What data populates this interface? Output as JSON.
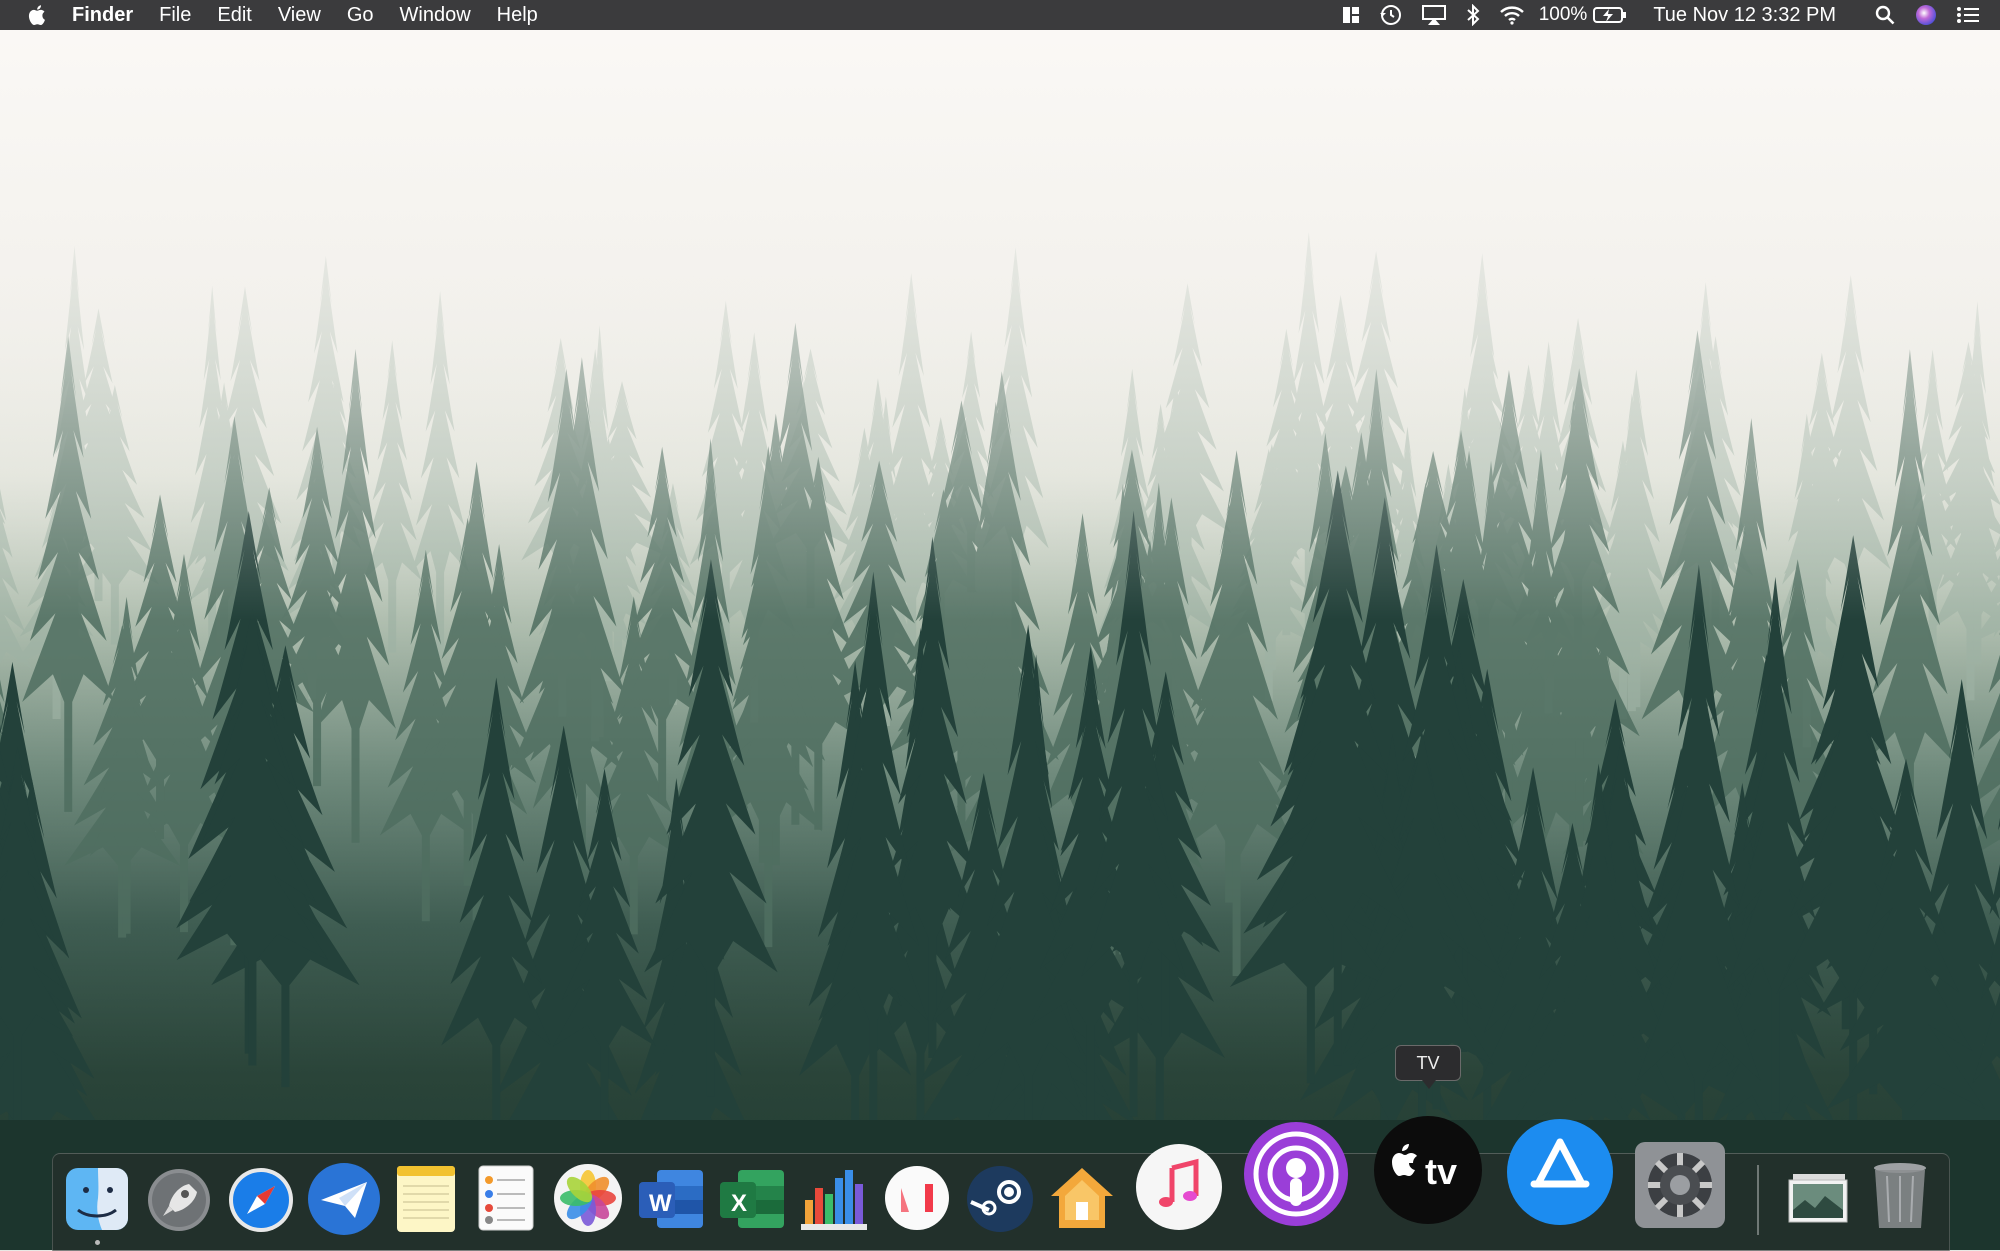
{
  "menubar": {
    "apple_icon": "apple-logo-icon",
    "app_name": "Finder",
    "menus": [
      "File",
      "Edit",
      "View",
      "Go",
      "Window",
      "Help"
    ],
    "battery_percent": "100%",
    "clock": "Tue Nov 12  3:32 PM",
    "status_icons": [
      "mission-control-icon",
      "time-machine-icon",
      "airplay-icon",
      "bluetooth-icon",
      "wifi-icon",
      "battery-charging-icon",
      "spotlight-search-icon",
      "siri-icon",
      "notification-center-icon"
    ]
  },
  "dock": {
    "tooltip": "TV",
    "apps": [
      "Finder",
      "Launchpad",
      "Safari",
      "Airmail",
      "Notes",
      "Reminders",
      "Photos",
      "Word",
      "Excel",
      "Numbers",
      "News",
      "Steam",
      "Home",
      "Music",
      "Podcasts",
      "TV",
      "App Store",
      "System Preferences",
      "Downloads",
      "Trash"
    ],
    "word_glyph": "W",
    "excel_glyph": "X",
    "tv_glyph": "tv"
  },
  "colors": {
    "menubar": "#3b3b3d",
    "safari": "#1a7de8",
    "podcasts": "#9a3ed8",
    "appstore": "#1c8cf0",
    "word": "#2b5eb8",
    "excel": "#1f7a43"
  }
}
